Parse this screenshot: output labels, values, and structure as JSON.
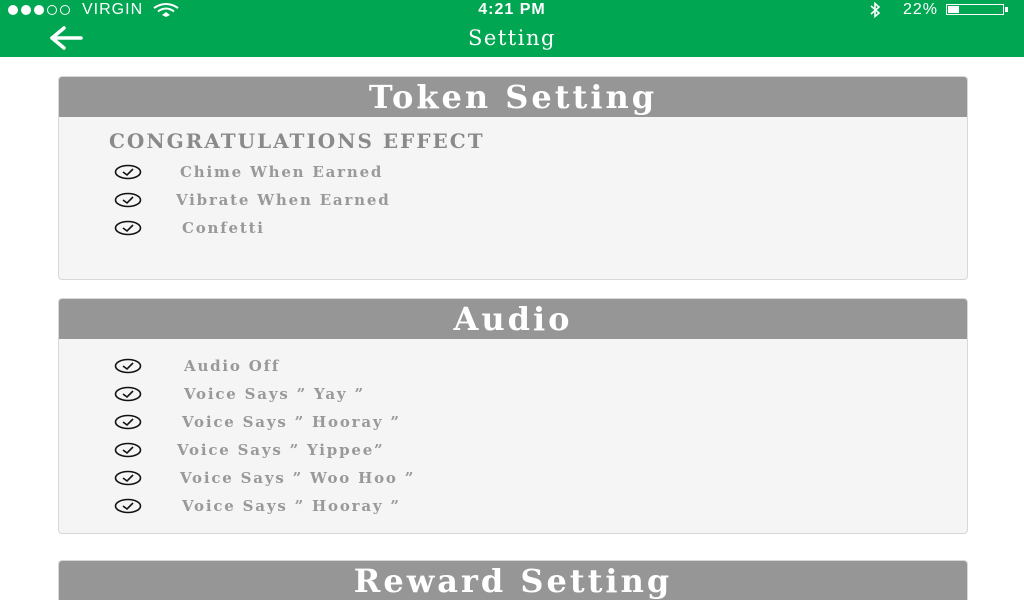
{
  "status_bar": {
    "carrier": "VIRGIN",
    "time": "4:21 PM",
    "battery_percent": "22%",
    "battery_level": 0.22,
    "signal_strength": 3
  },
  "nav": {
    "title": "Setting",
    "back_icon": "chevron-left-icon"
  },
  "token_setting": {
    "header": "Token Setting",
    "section_title": "CONGRATULATIONS EFFECT",
    "options": [
      {
        "label": "Chime When Earned",
        "checked": true
      },
      {
        "label": "Vibrate When Earned",
        "checked": true
      },
      {
        "label": "Confetti",
        "checked": true
      }
    ]
  },
  "audio": {
    "header": "Audio",
    "options": [
      {
        "label": "Audio Off",
        "checked": true
      },
      {
        "label": "Voice Says ” Yay ”",
        "checked": true
      },
      {
        "label": "Voice Says ” Hooray ”",
        "checked": true
      },
      {
        "label": "Voice Says ” Yippee”",
        "checked": true
      },
      {
        "label": "Voice Says ” Woo Hoo ”",
        "checked": true
      },
      {
        "label": "Voice Says ” Hooray ”",
        "checked": true
      }
    ]
  },
  "reward_setting": {
    "header": "Reward Setting"
  },
  "colors": {
    "brand_green": "#00a651",
    "card_header": "#969696",
    "card_body": "#f5f5f5"
  }
}
